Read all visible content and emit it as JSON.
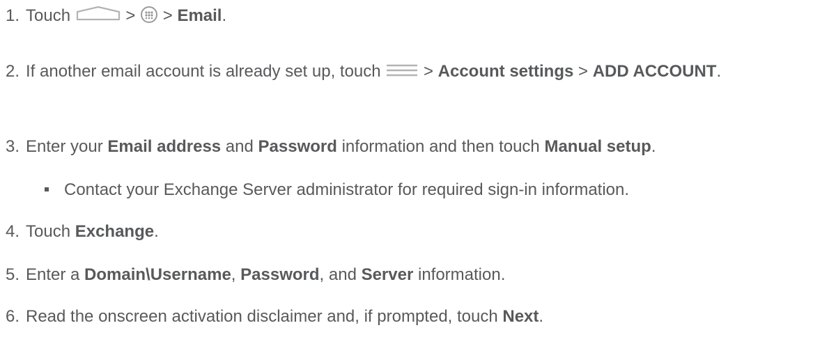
{
  "steps": [
    {
      "num": "1.",
      "t1": "Touch ",
      "icon1": "home-icon",
      "sep1": " > ",
      "icon2": "apps-icon",
      "sep2": " > ",
      "b1": "Email",
      "end": "."
    },
    {
      "num": "2.",
      "t1": "If another email account is already set up, touch ",
      "icon1": "menu-icon",
      "sep1": " > ",
      "b1": "Account settings",
      "sep2": " > ",
      "b2": "ADD ACCOUNT",
      "end": "."
    },
    {
      "num": "3.",
      "t1": "Enter your ",
      "b1": "Email address",
      "t2": " and ",
      "b2": "Password",
      "t3": " information and then touch ",
      "b3": "Manual setup",
      "end": "."
    },
    {
      "num": "4.",
      "t1": "Touch ",
      "b1": "Exchange",
      "end": "."
    },
    {
      "num": "5.",
      "t1": "Enter a ",
      "b1": "Domain\\Username",
      "t2": ", ",
      "b2": "Password",
      "t3": ", and ",
      "b3": "Server",
      "t4": " information."
    },
    {
      "num": "6.",
      "t1": "Read the onscreen activation disclaimer and, if prompted, touch ",
      "b1": "Next",
      "end": "."
    }
  ],
  "sub_bullet": "Contact your Exchange Server administrator for required sign-in information."
}
